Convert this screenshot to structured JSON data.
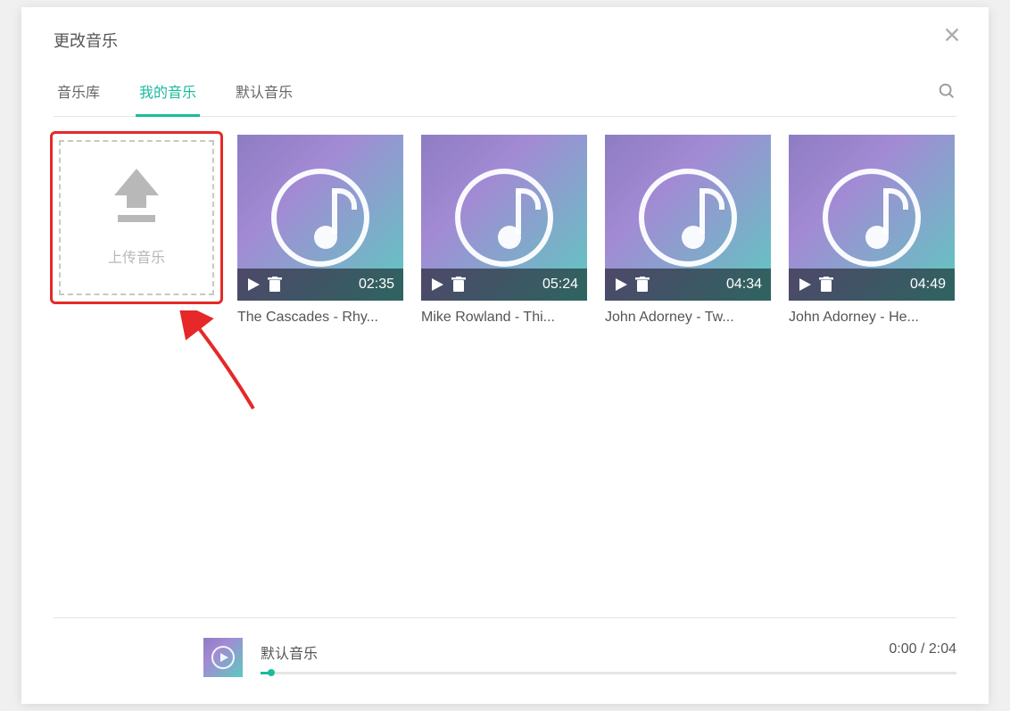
{
  "dialog": {
    "title": "更改音乐"
  },
  "tabs": {
    "library": "音乐库",
    "my_music": "我的音乐",
    "default_music": "默认音乐"
  },
  "upload": {
    "label": "上传音乐"
  },
  "tracks": [
    {
      "title": "The Cascades - Rhy...",
      "duration": "02:35"
    },
    {
      "title": "Mike Rowland - Thi...",
      "duration": "05:24"
    },
    {
      "title": "John Adorney - Tw...",
      "duration": "04:34"
    },
    {
      "title": "John Adorney - He...",
      "duration": "04:49"
    }
  ],
  "player": {
    "now_playing": "默认音乐",
    "time": "0:00 / 2:04"
  },
  "colors": {
    "accent": "#1abc9c",
    "highlight": "#e62828"
  }
}
